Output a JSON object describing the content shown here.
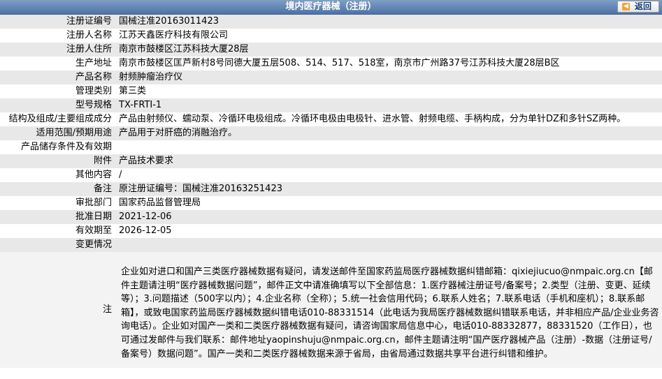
{
  "header": {
    "title": "境内医疗器械（注册）",
    "back_label": "返回"
  },
  "rows": [
    {
      "label": "注册证编号",
      "value": "国械注准20163011423"
    },
    {
      "label": "注册人名称",
      "value": "江苏天鑫医疗科技有限公司"
    },
    {
      "label": "注册人住所",
      "value": "南京市鼓楼区江苏科技大厦28层"
    },
    {
      "label": "生产地址",
      "value": "南京市鼓楼区匡芦新村8号同德大厦五层508、514、517、518室，南京市广州路37号江苏科技大厦28层B区"
    },
    {
      "label": "产品名称",
      "value": "射频肿瘤治疗仪"
    },
    {
      "label": "管理类别",
      "value": "第三类"
    },
    {
      "label": "型号规格",
      "value": "TX-FRTI-1"
    },
    {
      "label": "结构及组成/主要组成成分",
      "value": "产品由射频仪、蠕动泵、冷循环电极组成。冷循环电极由电极针、进水管、射频电缆、手柄构成，分为单针DZ和多针SZ两种。"
    },
    {
      "label": "适用范围/预期用途",
      "value": "产品用于对肝癌的消融治疗。"
    },
    {
      "label": "产品储存条件及有效期",
      "value": ""
    },
    {
      "label": "附件",
      "value": "产品技术要求"
    },
    {
      "label": "其他内容",
      "value": "/"
    },
    {
      "label": "备注",
      "value": "原注册证编号：国械注准20163251423"
    },
    {
      "label": "审批部门",
      "value": "国家药品监督管理局"
    },
    {
      "label": "批准日期",
      "value": "2021-12-06"
    },
    {
      "label": "有效期至",
      "value": "2026-12-05"
    },
    {
      "label": "变更情况",
      "value": ""
    }
  ],
  "note": {
    "label": "注",
    "text": "企业如对进口和国产三类医疗器械数据有疑问，请发送邮件至国家药监局医疗器械数据纠错邮箱：qixiejiucuo@nmpaic.org.cn【邮件主题请注明“医疗器械数据问题”，邮件正文中请准确填写以下全部信息：1.医疗器械注册证号/备案号；2.类型（注册、变更、延续等）；3.问题描述（500字以内）；4.企业名称（全称）；5.统一社会信用代码；6.联系人姓名；7.联系电话（手机和座机）；8.联系邮箱】，或致电国家药监局医疗器械数据纠错电话010-88331514（此电话为我局医疗器械数据纠错联系电话，并非相应产品/企业业务咨询电话）。企业如对国产一类和二类医疗器械数据有疑问，请咨询国家局信息中心，电话010-88332877，88331520（工作日），也可通过发邮件与我们联系：邮件地址yaopinshuju@nmpaic.org.cn，邮件主题请注明“国产医疗器械产品（注册）-数据（注册证号/备案号）数据问题”。国产一类和二类医疗器械数据来源于省局，由省局通过数据共享平台进行纠错和维护。"
  }
}
